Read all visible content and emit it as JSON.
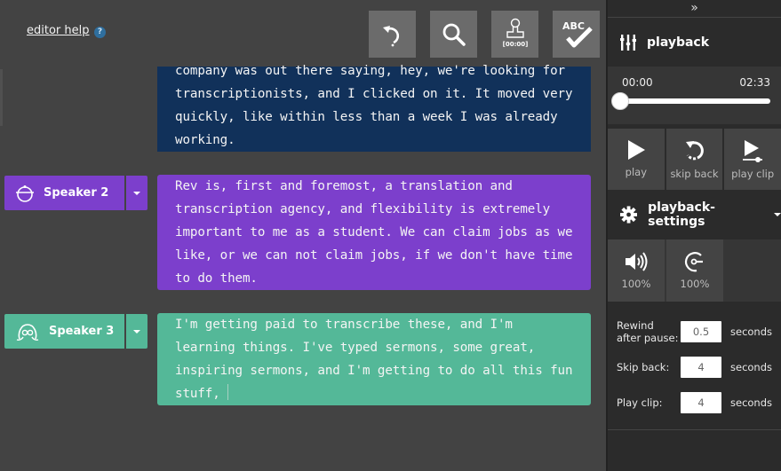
{
  "editor": {
    "help_label": "editor help",
    "help_badge": "?",
    "toolbar": [
      {
        "name": "undo",
        "icon": "undo-icon"
      },
      {
        "name": "search",
        "icon": "search-icon"
      },
      {
        "name": "timestamp",
        "icon": "timestamp-stamp-icon",
        "label": "[00:00]"
      },
      {
        "name": "spellcheck",
        "icon": "spellcheck-icon",
        "label": "ABC"
      }
    ],
    "blocks": [
      {
        "speaker": "",
        "color": "#11315a",
        "text": "company was out there saying, hey, we're looking for transcriptionists, and I clicked on it. It moved very quickly, like within less than a week I was already working."
      },
      {
        "speaker": "Speaker 2",
        "color": "#7c3fcc",
        "text": "Rev is, first and foremost, a translation and transcription agency, and flexibility  is extremely important to me as a student. We can claim jobs as we like, or we can not claim jobs, if we don't have time to do them."
      },
      {
        "speaker": "Speaker 3",
        "color": "#54b898",
        "text": "I'm getting paid to transcribe these, and I'm learning things. I've typed sermons, some great, inspiring sermons, and I'm getting to do all this fun stuff,"
      }
    ]
  },
  "panel": {
    "collapse_label": "»",
    "playback_title": "playback",
    "time_current": "00:00",
    "time_total": "02:33",
    "progress_fraction": 0.0,
    "controls": [
      {
        "label": "play",
        "icon": "play-icon"
      },
      {
        "label": "skip back",
        "icon": "skip-back-icon"
      },
      {
        "label": "play clip",
        "icon": "play-clip-icon"
      }
    ],
    "settings_title": "playback-settings",
    "volume_label": "100%",
    "speed_label": "100%",
    "fields": [
      {
        "label": "Rewind after pause:",
        "value": "0.5",
        "unit": "seconds"
      },
      {
        "label": "Skip back:",
        "value": "4",
        "unit": "seconds"
      },
      {
        "label": "Play clip:",
        "value": "4",
        "unit": "seconds"
      }
    ]
  }
}
